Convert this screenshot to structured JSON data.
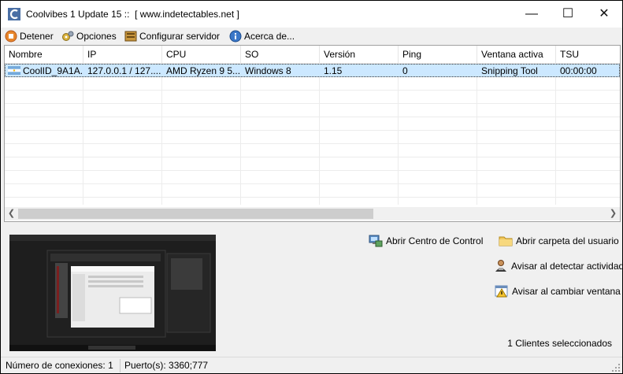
{
  "window": {
    "title": "Coolvibes 1 Update 15 ::  [ www.indetectables.net ]",
    "controls": {
      "minimize": "—",
      "maximize": "☐",
      "close": "✕"
    }
  },
  "toolbar": [
    {
      "label": "Detener",
      "icon": "stop-icon"
    },
    {
      "label": "Opciones",
      "icon": "gears-icon"
    },
    {
      "label": "Configurar servidor",
      "icon": "server-icon"
    },
    {
      "label": "Acerca de...",
      "icon": "info-icon"
    }
  ],
  "table": {
    "columns": [
      "Nombre",
      "IP",
      "CPU",
      "SO",
      "Versión",
      "Ping",
      "Ventana activa",
      "TSU"
    ],
    "rows": [
      [
        "CoolID_9A1A...",
        "127.0.0.1 / 127....",
        "AMD Ryzen 9 5...",
        "Windows 8",
        "1.15",
        "0",
        "Snipping Tool",
        "00:00:00"
      ]
    ]
  },
  "actions": {
    "open_control": "Abrir Centro de Control",
    "open_folder": "Abrir carpeta del usuario",
    "notify_activity": "Avisar al detectar actividad",
    "notify_window": "Avisar al cambiar ventana"
  },
  "selection": "1 Clientes seleccionados",
  "status": {
    "connections": "Número de conexiones: 1",
    "ports": "Puerto(s): 3360;777"
  },
  "colors": {
    "selected_row": "#cce8ff",
    "window_bg": "#f0f0f0"
  }
}
